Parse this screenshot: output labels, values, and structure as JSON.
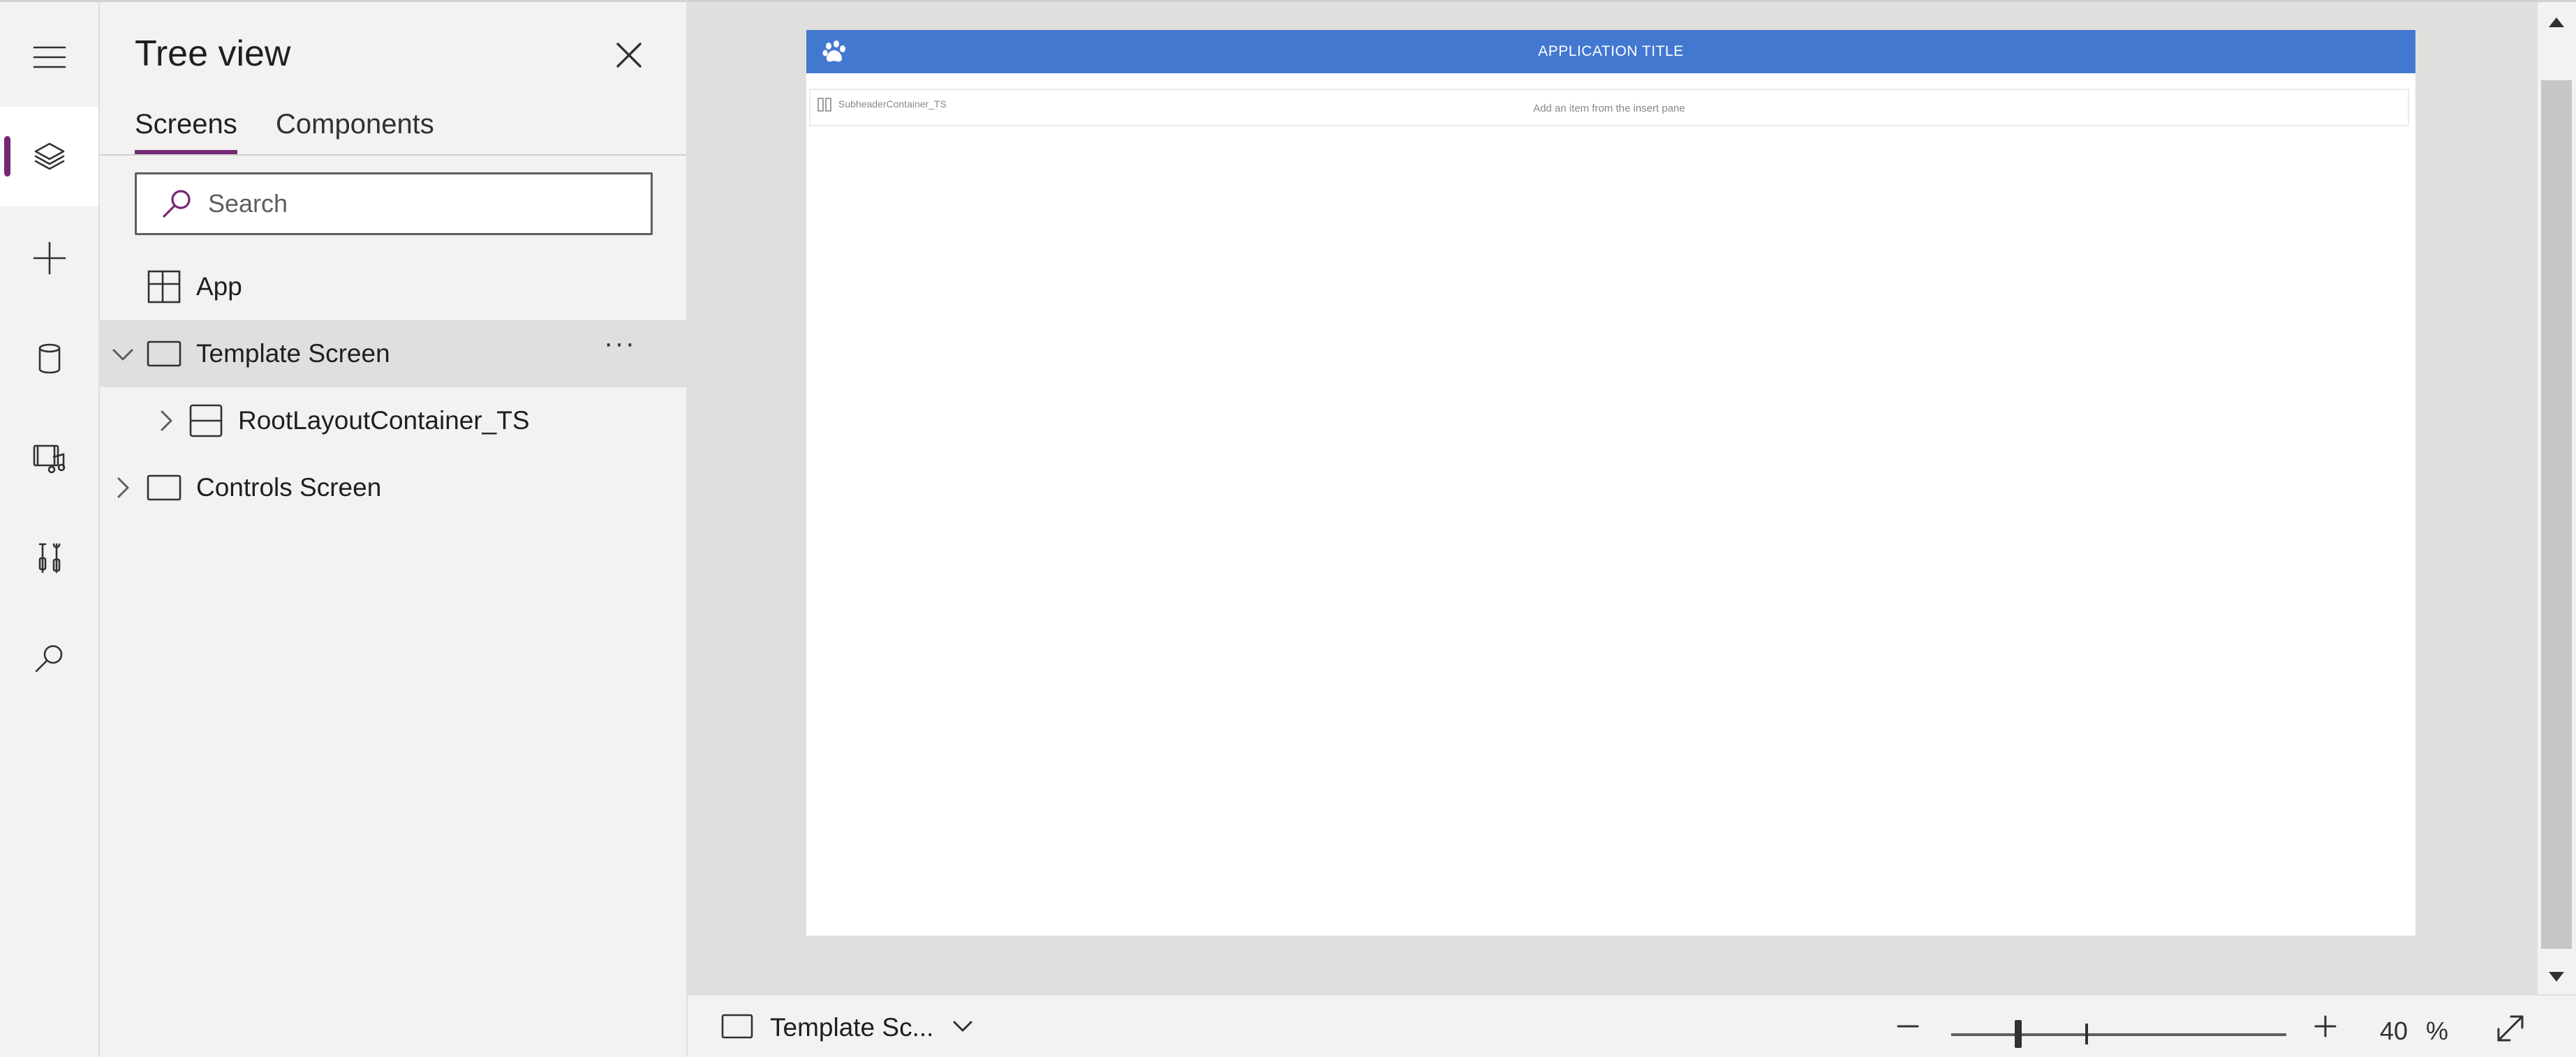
{
  "rail": {
    "items": [
      {
        "name": "menu-icon"
      },
      {
        "name": "tree-view-layers-icon",
        "active": true
      },
      {
        "name": "insert-plus-icon"
      },
      {
        "name": "data-cylinder-icon"
      },
      {
        "name": "media-icon"
      },
      {
        "name": "advanced-tools-icon"
      },
      {
        "name": "search-icon"
      }
    ],
    "accent_color": "#742774"
  },
  "tree_panel": {
    "title": "Tree view",
    "tabs": [
      {
        "label": "Screens",
        "active": true
      },
      {
        "label": "Components",
        "active": false
      }
    ],
    "search": {
      "placeholder": "Search",
      "value": ""
    },
    "nodes": [
      {
        "label": "App",
        "icon": "app-icon",
        "expandable": false,
        "selected": false
      },
      {
        "label": "Template Screen",
        "icon": "screen-icon",
        "expandable": true,
        "expanded": true,
        "selected": true,
        "more": "···"
      },
      {
        "label": "RootLayoutContainer_TS",
        "icon": "container-icon",
        "expandable": true,
        "expanded": false,
        "selected": false
      },
      {
        "label": "Controls Screen",
        "icon": "screen-icon",
        "expandable": true,
        "expanded": false,
        "selected": false
      }
    ]
  },
  "canvas": {
    "app_title": "APPLICATION TITLE",
    "header_color": "#4378d0",
    "subheader_name": "SubheaderContainer_TS",
    "subheader_hint": "Add an item from the insert pane"
  },
  "statusbar": {
    "screen_label": "Template Sc...",
    "zoom_value": "40",
    "zoom_unit": "%",
    "zoom_fraction": 0.2
  }
}
